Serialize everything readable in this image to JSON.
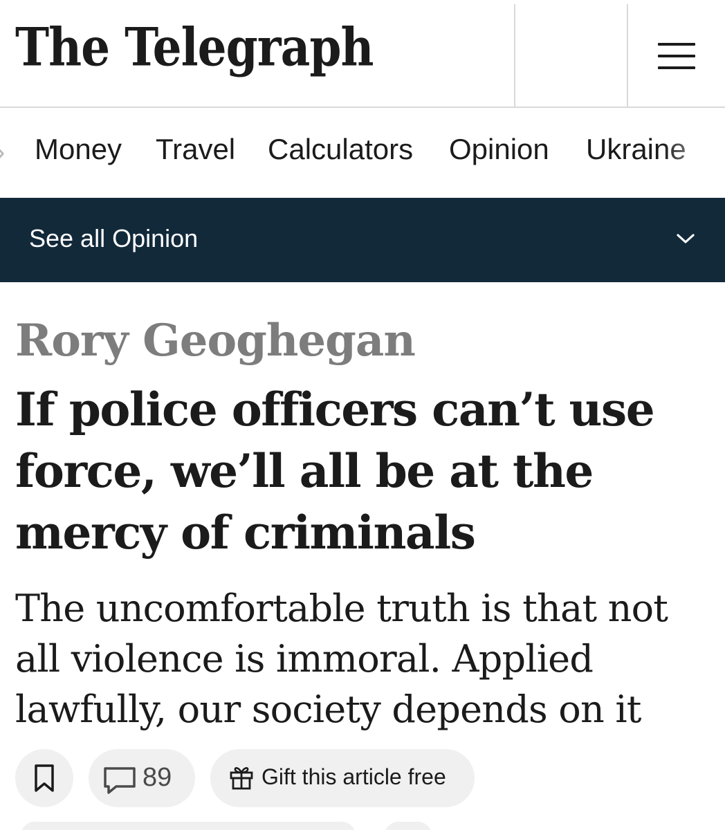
{
  "masthead": {
    "logo_text": "The Telegraph",
    "menu_icon": "hamburger-menu-icon"
  },
  "nav": {
    "items": [
      {
        "label": "Money"
      },
      {
        "label": "Travel"
      },
      {
        "label": "Calculators"
      },
      {
        "label": "Opinion"
      },
      {
        "label": "Ukraine"
      }
    ]
  },
  "section_bar": {
    "label": "See all Opinion",
    "icon": "chevron-down-icon",
    "background": "#12293a"
  },
  "article": {
    "author": "Rory Geoghegan",
    "headline": "If police officers can’t use force, we’ll all be at the mercy of criminals",
    "standfirst": "The uncomfortable truth is that not all violence is immoral. Applied lawfully, our society depends on it"
  },
  "actions": {
    "save_icon": "bookmark-icon",
    "comment_icon": "comment-icon",
    "comment_count": "89",
    "gift_icon": "gift-icon",
    "gift_label": "Gift this article free"
  }
}
